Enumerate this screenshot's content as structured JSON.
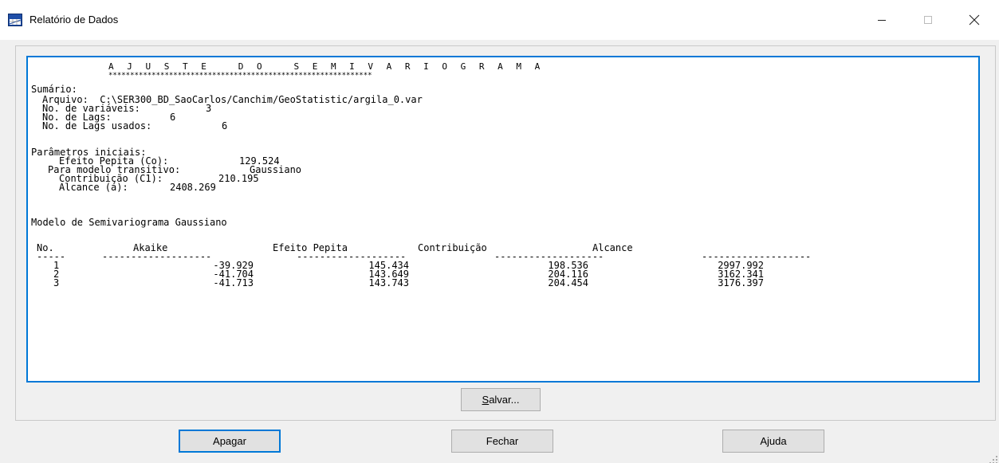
{
  "window": {
    "title": "Relatório de Dados"
  },
  "report": {
    "heading": "A J U S T E   D O   S E M I V A R I O G R A M A",
    "underline": "*************************************************************",
    "summary_label": "Sumário:",
    "file_line": "Arquivo:  C:\\SER300_BD_SaoCarlos/Canchim/GeoStatistic/argila_0.var",
    "num_vars_label": "No. de variáveis:",
    "num_vars_value": "3",
    "num_lags_label": "No. de Lags:",
    "num_lags_value": "6",
    "num_lags_used_label": "No. de Lags usados:",
    "num_lags_used_value": "6",
    "initial_params_label": "Parâmetros iniciais:",
    "nugget_label": "Efeito Pepita (Co):",
    "nugget_value": "129.524",
    "transitive_label": "Para modelo transitivo:",
    "transitive_value": "Gaussiano",
    "contribution_label": "Contribuição (C1):",
    "contribution_value": "210.195",
    "range_label": "Alcance (a):",
    "range_value": "2408.269",
    "model_title": "Modelo de Semivariograma Gaussiano",
    "table": {
      "headers": [
        "No.",
        "Akaike",
        "Efeito Pepita",
        "Contribuição",
        "Alcance"
      ],
      "dashes": [
        "-----",
        "-------------------",
        "-------------------",
        "-------------------",
        "-------------------"
      ],
      "rows": [
        [
          "1",
          "-39.929",
          "145.434",
          "198.536",
          "2997.992"
        ],
        [
          "2",
          "-41.704",
          "143.649",
          "204.116",
          "3162.341"
        ],
        [
          "3",
          "-41.713",
          "143.743",
          "204.454",
          "3176.397"
        ]
      ]
    }
  },
  "buttons": {
    "save_prefix": "S",
    "save_rest": "alvar...",
    "clear": "Apagar",
    "close": "Fechar",
    "help": "Ajuda"
  }
}
